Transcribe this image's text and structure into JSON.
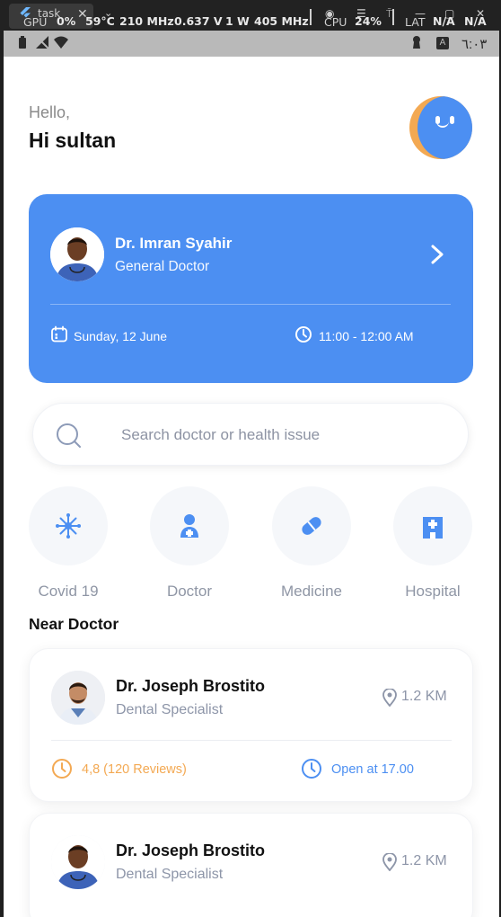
{
  "overlay": {
    "tab_title": "task",
    "gpu_label": "GPU",
    "gpu_value": "0%",
    "temp": "59°C",
    "clock": "210 MHz",
    "voltage": "0.637 V",
    "power": "1 W",
    "mem_clock": "405 MHz",
    "cpu_label": "CPU",
    "cpu_value": "24%",
    "lat_label": "LAT",
    "lat_value": "N/A",
    "extra_value": "N/A"
  },
  "status_bar": {
    "time": "٦:٠٣",
    "keyboard_indicator": "A"
  },
  "greeting": {
    "hello": "Hello,",
    "name": "Hi sultan"
  },
  "appointment": {
    "doctor_name": "Dr. Imran Syahir",
    "specialty": "General Doctor",
    "date": "Sunday, 12 June",
    "time": "11:00 - 12:00 AM",
    "card_color": "#4c8ff2"
  },
  "search": {
    "placeholder": "Search doctor or health issue"
  },
  "categories": [
    {
      "label": "Covid 19",
      "icon": "virus-icon"
    },
    {
      "label": "Doctor",
      "icon": "doctor-icon"
    },
    {
      "label": "Medicine",
      "icon": "pill-icon"
    },
    {
      "label": "Hospital",
      "icon": "hospital-icon"
    }
  ],
  "near_doctor": {
    "title": "Near Doctor",
    "doctors": [
      {
        "name": "Dr. Joseph Brostito",
        "specialty": "Dental Specialist",
        "distance": "1.2 KM",
        "rating": "4,8 (120 Reviews)",
        "open": "Open at 17.00"
      },
      {
        "name": "Dr. Joseph Brostito",
        "specialty": "Dental Specialist",
        "distance": "1.2 KM"
      }
    ]
  },
  "colors": {
    "accent": "#4c8ff2",
    "rating": "#f3a953",
    "muted": "#8d95a8"
  }
}
